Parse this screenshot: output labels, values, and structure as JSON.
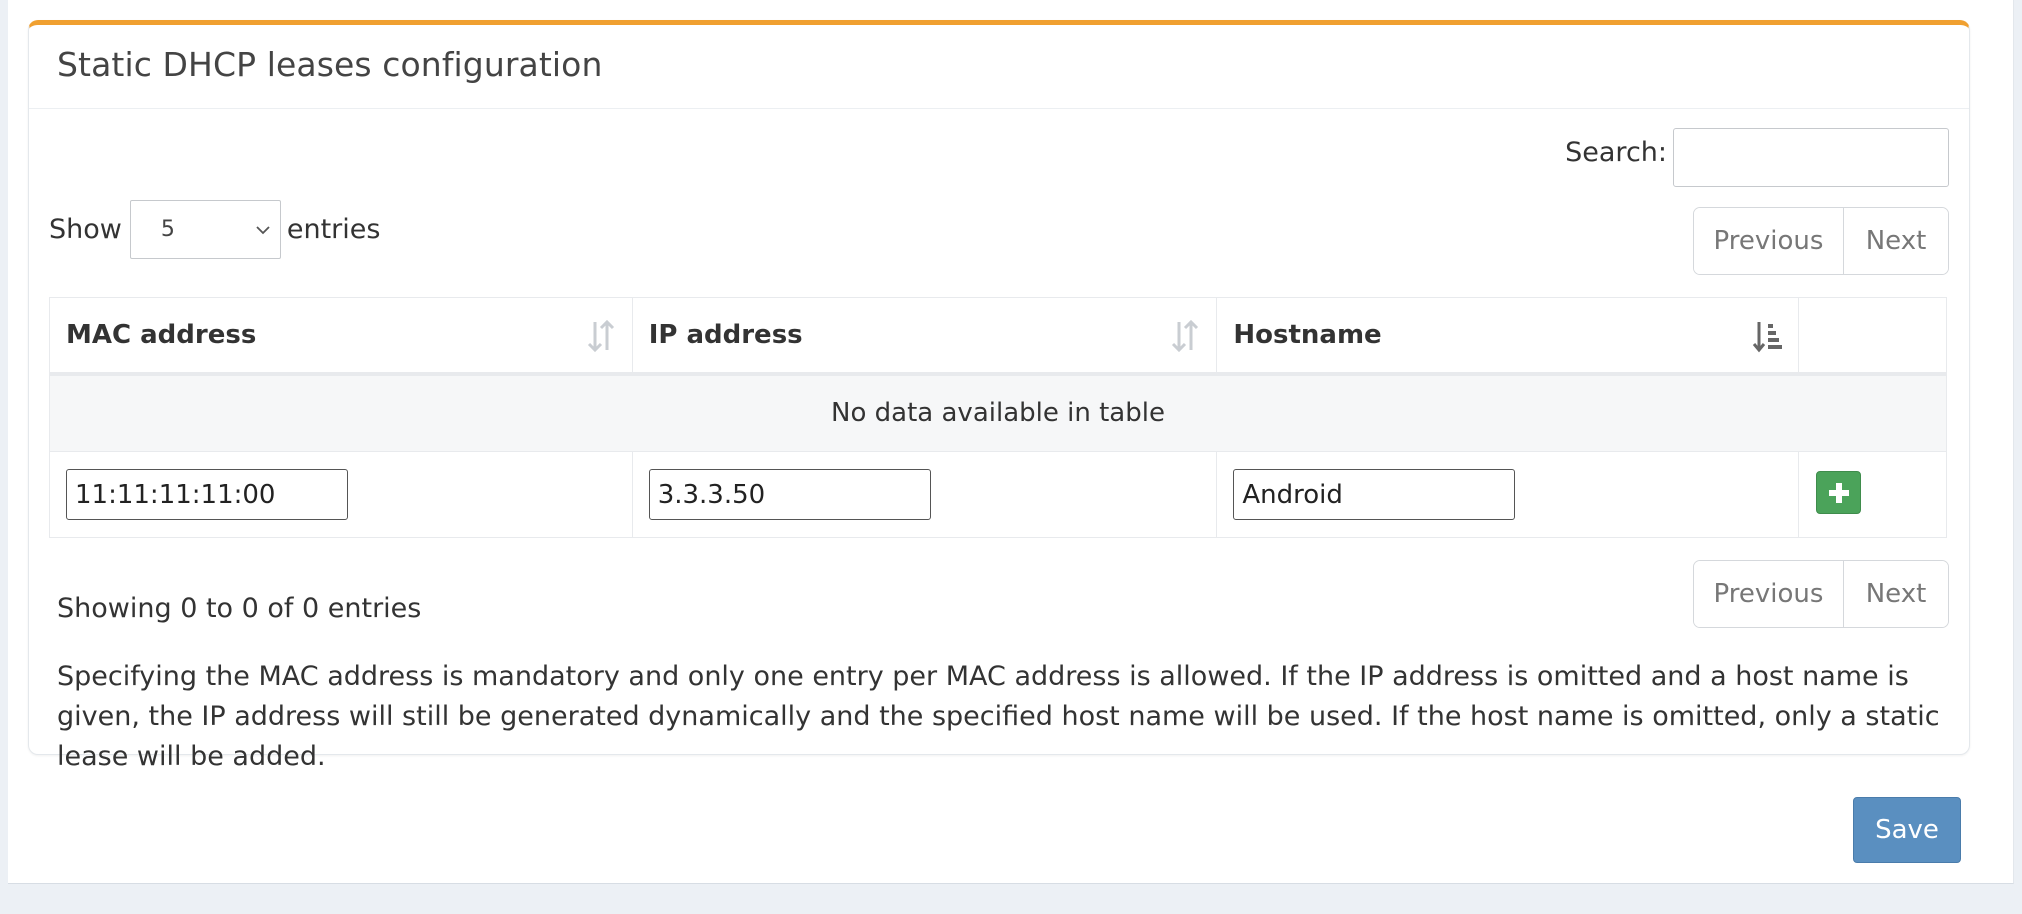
{
  "panel": {
    "title": "Static DHCP leases configuration",
    "accent_color": "#f0a030"
  },
  "search": {
    "label": "Search:",
    "value": ""
  },
  "length": {
    "show_label": "Show",
    "selected": "5",
    "entries_label": "entries"
  },
  "pagination": {
    "previous": "Previous",
    "next": "Next"
  },
  "table": {
    "columns": [
      "MAC address",
      "IP address",
      "Hostname",
      ""
    ],
    "sort_icons": [
      "sort-both-icon",
      "sort-both-icon",
      "sort-ascending-icon"
    ],
    "empty_message": "No data available in table",
    "new_row": {
      "mac": "11:11:11:11:00",
      "ip": "3.3.3.50",
      "hostname": "Android"
    }
  },
  "info": "Showing 0 to 0 of 0 entries",
  "help_text": "Specifying the MAC address is mandatory and only one entry per MAC address is allowed. If the IP address is omitted and a host name is given, the IP address will still be generated dynamically and the specified host name will be used. If the host name is omitted, only a static lease will be added.",
  "actions": {
    "save": "Save"
  },
  "colors": {
    "add_button": "#4ba35a",
    "save_button": "#5a8fc0"
  }
}
